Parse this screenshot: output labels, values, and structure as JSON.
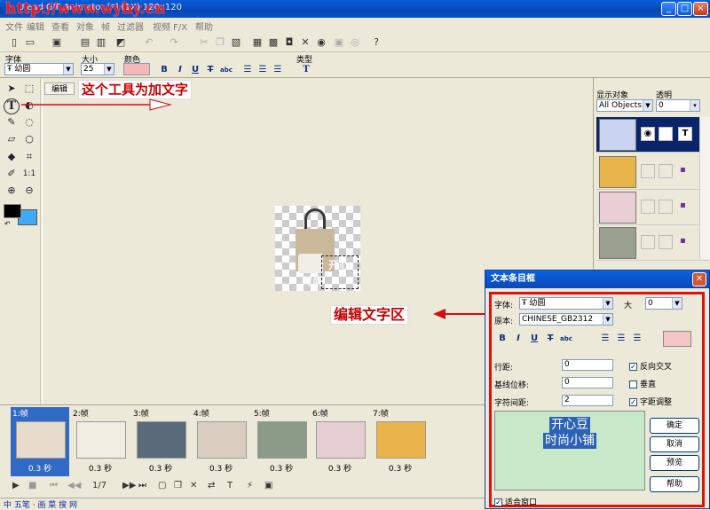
{
  "window": {
    "watermark": "http://www.wyhy.cn",
    "title_suffix": "[*] (1X) 120x120",
    "controls": [
      "_",
      "□",
      "×"
    ]
  },
  "menu": [
    "文件",
    "编辑",
    "查看",
    "对象",
    "帧",
    "过滤器",
    "视频 F/X",
    "帮助"
  ],
  "toolbar": {
    "icons": [
      "new-icon",
      "open-icon",
      "save-icon",
      "import-icon",
      "export-icon",
      "wizard-icon",
      "undo-icon",
      "redo-icon",
      "cut-icon",
      "copy-icon",
      "paste-icon",
      "frame-icon",
      "crop-icon",
      "snapshot-icon",
      "delete-icon",
      "web-icon",
      "preview-icon",
      "browser-icon",
      "help-icon"
    ]
  },
  "text_props": {
    "font_label": "字体",
    "font_value": "幼圆",
    "size_label": "大小",
    "size_value": "25",
    "color_label": "颜色",
    "color_value": "#f5b8b8",
    "type_label": "类型",
    "format_buttons": [
      "B",
      "I",
      "U",
      "T",
      "abc"
    ]
  },
  "tools": [
    "pointer-tool-icon",
    "marquee-tool-icon",
    "text-tool-icon",
    "cursor-tool-icon",
    "brush-tool-icon",
    "lasso-tool-icon",
    "eraser-tool-icon",
    "ellipse-tool-icon",
    "fill-tool-icon",
    "crop-tool-icon",
    "eyedropper-tool-icon",
    "actual-size-icon",
    "zoom-in-icon",
    "zoom-out-icon"
  ],
  "editor": {
    "tab_label": "编辑",
    "canvas_texts": [
      "开心",
      "时尚"
    ]
  },
  "callouts": {
    "tool": "这个工具为加文字",
    "area": "编辑文字区"
  },
  "objects": {
    "show_label": "显示对象",
    "show_value": "All Objects",
    "opacity_label": "透明",
    "opacity_value": "0"
  },
  "timeline": {
    "frames": [
      {
        "label": "1:帧",
        "duration": "0.3 秒"
      },
      {
        "label": "2:帧",
        "duration": "0.3 秒"
      },
      {
        "label": "3:帧",
        "duration": "0.3 秒"
      },
      {
        "label": "4:帧",
        "duration": "0.3 秒"
      },
      {
        "label": "5:帧",
        "duration": "0.3 秒"
      },
      {
        "label": "6:帧",
        "duration": "0.3 秒"
      },
      {
        "label": "7:帧",
        "duration": "0.3 秒"
      }
    ],
    "page": "1/7"
  },
  "status": "中 五笔 · 画 菜 搜 网",
  "dialog": {
    "title": "文本条目框",
    "font_label": "字体:",
    "font_value": "幼圆",
    "size_label": "大",
    "size_value": "0",
    "charset_label": "原本:",
    "charset_value": "CHINESE_GB2312",
    "format_buttons": [
      "B",
      "I",
      "U",
      "T",
      "abc"
    ],
    "color_value": "#f5c6c6",
    "line_spacing_label": "行距:",
    "line_spacing_value": "0",
    "baseline_label": "基线位移:",
    "baseline_value": "0",
    "char_spacing_label": "字符间距:",
    "char_spacing_value": "2",
    "antialias_label": "反向交叉",
    "vertical_label": "垂直",
    "kerning_label": "字距调整",
    "preview_lines": [
      "开心豆",
      "时尚小铺"
    ],
    "ok": "确定",
    "cancel": "取消",
    "preview_btn": "预览",
    "help": "帮助",
    "fit_label": "适合窗口"
  }
}
